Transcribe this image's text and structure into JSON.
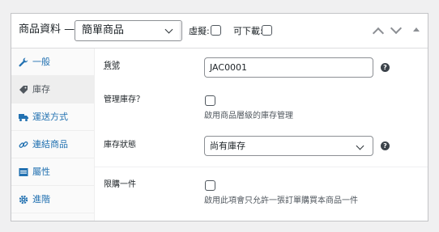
{
  "header": {
    "title": "商品資料 —",
    "product_type": "簡單商品",
    "virtual_label": "虛擬:",
    "downloadable_label": "可下載:"
  },
  "sidebar": {
    "items": [
      {
        "label": "一般",
        "icon": "wrench-icon"
      },
      {
        "label": "庫存",
        "icon": "tag-icon",
        "active": true
      },
      {
        "label": "運送方式",
        "icon": "truck-icon"
      },
      {
        "label": "連結商品",
        "icon": "link-icon"
      },
      {
        "label": "屬性",
        "icon": "table-icon"
      },
      {
        "label": "進階",
        "icon": "gear-icon"
      }
    ]
  },
  "inventory": {
    "sku_label": "貨號",
    "sku_value": "JAC0001",
    "manage_label": "管理庫存？",
    "manage_desc": "啟用商品層級的庫存管理",
    "status_label": "庫存狀態",
    "status_value": "尚有庫存",
    "sold_individually_label": "限購一件",
    "sold_individually_desc": "啟用此項會只允許一張訂單購買本商品一件",
    "help_glyph": "?"
  },
  "colors": {
    "link": "#2271b1",
    "border": "#c3c4c7",
    "background": "#f0f0f1"
  }
}
